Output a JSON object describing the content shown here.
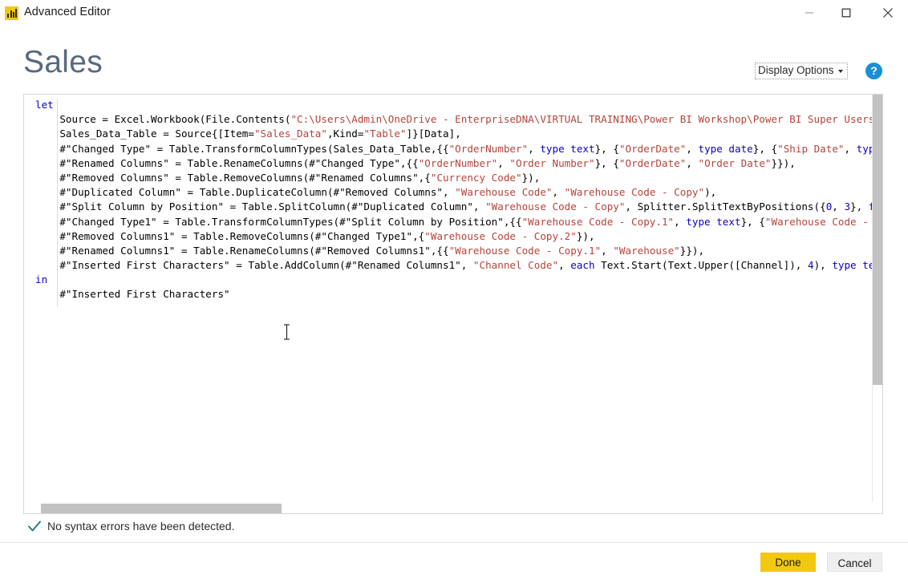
{
  "window": {
    "app_icon": "power-bi-icon",
    "title": "Advanced Editor",
    "controls": {
      "minimize": "minimize-icon",
      "maximize": "maximize-icon",
      "close": "close-icon"
    }
  },
  "header": {
    "query_name": "Sales",
    "display_options_label": "Display Options",
    "display_options_caret": "chevron-down-icon",
    "help_label": "?",
    "help_icon": "help-icon"
  },
  "editor": {
    "language": "M",
    "lines": [
      [
        {
          "t": "let",
          "c": "kw"
        }
      ],
      [
        {
          "t": "    Source = Excel.Workbook(File.Contents(",
          "c": ""
        },
        {
          "t": "\"C:\\Users\\Admin\\OneDrive - EnterpriseDNA\\VIRTUAL TRAINING\\Power BI Workshop\\Power BI Super Users Wo",
          "c": "str"
        }
      ],
      [
        {
          "t": "    Sales_Data_Table = Source{[Item=",
          "c": ""
        },
        {
          "t": "\"Sales_Data\"",
          "c": "str"
        },
        {
          "t": ",Kind=",
          "c": ""
        },
        {
          "t": "\"Table\"",
          "c": "str"
        },
        {
          "t": "]}[Data],",
          "c": ""
        }
      ],
      [
        {
          "t": "    #\"Changed Type\" = Table.TransformColumnTypes(Sales_Data_Table,{{",
          "c": ""
        },
        {
          "t": "\"OrderNumber\"",
          "c": "str"
        },
        {
          "t": ", ",
          "c": ""
        },
        {
          "t": "type text",
          "c": "kw"
        },
        {
          "t": "}, {",
          "c": ""
        },
        {
          "t": "\"OrderDate\"",
          "c": "str"
        },
        {
          "t": ", ",
          "c": ""
        },
        {
          "t": "type date",
          "c": "kw"
        },
        {
          "t": "}, {",
          "c": ""
        },
        {
          "t": "\"Ship Date\"",
          "c": "str"
        },
        {
          "t": ", ",
          "c": ""
        },
        {
          "t": "type d",
          "c": "kw"
        }
      ],
      [
        {
          "t": "    #\"Renamed Columns\" = Table.RenameColumns(#\"Changed Type\",{{",
          "c": ""
        },
        {
          "t": "\"OrderNumber\"",
          "c": "str"
        },
        {
          "t": ", ",
          "c": ""
        },
        {
          "t": "\"Order Number\"",
          "c": "str"
        },
        {
          "t": "}, {",
          "c": ""
        },
        {
          "t": "\"OrderDate\"",
          "c": "str"
        },
        {
          "t": ", ",
          "c": ""
        },
        {
          "t": "\"Order Date\"",
          "c": "str"
        },
        {
          "t": "}}),",
          "c": ""
        }
      ],
      [
        {
          "t": "    #\"Removed Columns\" = Table.RemoveColumns(#\"Renamed Columns\",{",
          "c": ""
        },
        {
          "t": "\"Currency Code\"",
          "c": "str"
        },
        {
          "t": "}),",
          "c": ""
        }
      ],
      [
        {
          "t": "    #\"Duplicated Column\" = Table.DuplicateColumn(#\"Removed Columns\", ",
          "c": ""
        },
        {
          "t": "\"Warehouse Code\"",
          "c": "str"
        },
        {
          "t": ", ",
          "c": ""
        },
        {
          "t": "\"Warehouse Code - Copy\"",
          "c": "str"
        },
        {
          "t": "),",
          "c": ""
        }
      ],
      [
        {
          "t": "    #\"Split Column by Position\" = Table.SplitColumn(#\"Duplicated Column\", ",
          "c": ""
        },
        {
          "t": "\"Warehouse Code - Copy\"",
          "c": "str"
        },
        {
          "t": ", Splitter.SplitTextByPositions({",
          "c": ""
        },
        {
          "t": "0",
          "c": "num"
        },
        {
          "t": ", ",
          "c": ""
        },
        {
          "t": "3",
          "c": "num"
        },
        {
          "t": "}, ",
          "c": ""
        },
        {
          "t": "fals",
          "c": "kw"
        }
      ],
      [
        {
          "t": "    #\"Changed Type1\" = Table.TransformColumnTypes(#\"Split Column by Position\",{{",
          "c": ""
        },
        {
          "t": "\"Warehouse Code - Copy.1\"",
          "c": "str"
        },
        {
          "t": ", ",
          "c": ""
        },
        {
          "t": "type text",
          "c": "kw"
        },
        {
          "t": "}, {",
          "c": ""
        },
        {
          "t": "\"Warehouse Code - Cop",
          "c": "str"
        }
      ],
      [
        {
          "t": "    #\"Removed Columns1\" = Table.RemoveColumns(#\"Changed Type1\",{",
          "c": ""
        },
        {
          "t": "\"Warehouse Code - Copy.2\"",
          "c": "str"
        },
        {
          "t": "}),",
          "c": ""
        }
      ],
      [
        {
          "t": "    #\"Renamed Columns1\" = Table.RenameColumns(#\"Removed Columns1\",{{",
          "c": ""
        },
        {
          "t": "\"Warehouse Code - Copy.1\"",
          "c": "str"
        },
        {
          "t": ", ",
          "c": ""
        },
        {
          "t": "\"Warehouse\"",
          "c": "str"
        },
        {
          "t": "}}),",
          "c": ""
        }
      ],
      [
        {
          "t": "    #\"Inserted First Characters\" = Table.AddColumn(#\"Renamed Columns1\", ",
          "c": ""
        },
        {
          "t": "\"Channel Code\"",
          "c": "str"
        },
        {
          "t": ", ",
          "c": ""
        },
        {
          "t": "each",
          "c": "kw"
        },
        {
          "t": " Text.Start(Text.Upper([Channel]), ",
          "c": ""
        },
        {
          "t": "4",
          "c": "num"
        },
        {
          "t": "), ",
          "c": ""
        },
        {
          "t": "type text",
          "c": "kw"
        },
        {
          "t": ")",
          "c": ""
        }
      ],
      [
        {
          "t": "in",
          "c": "kw"
        }
      ],
      [
        {
          "t": "    #\"Inserted First Characters\"",
          "c": ""
        }
      ]
    ],
    "vertical_scrollbar": "vertical-scrollbar",
    "horizontal_scrollbar": "horizontal-scrollbar"
  },
  "status": {
    "icon": "checkmark-icon",
    "message": "No syntax errors have been detected."
  },
  "footer": {
    "done_label": "Done",
    "cancel_label": "Cancel"
  },
  "colors": {
    "accent_yellow": "#F2C811",
    "title_blue_gray": "#56697e",
    "keyword": "#0b00c9",
    "string": "#b5443b",
    "check_teal": "#1f7a72",
    "scrollbar_thumb": "#c2c2c2"
  },
  "cursor": {
    "type": "ibeam-cursor"
  }
}
